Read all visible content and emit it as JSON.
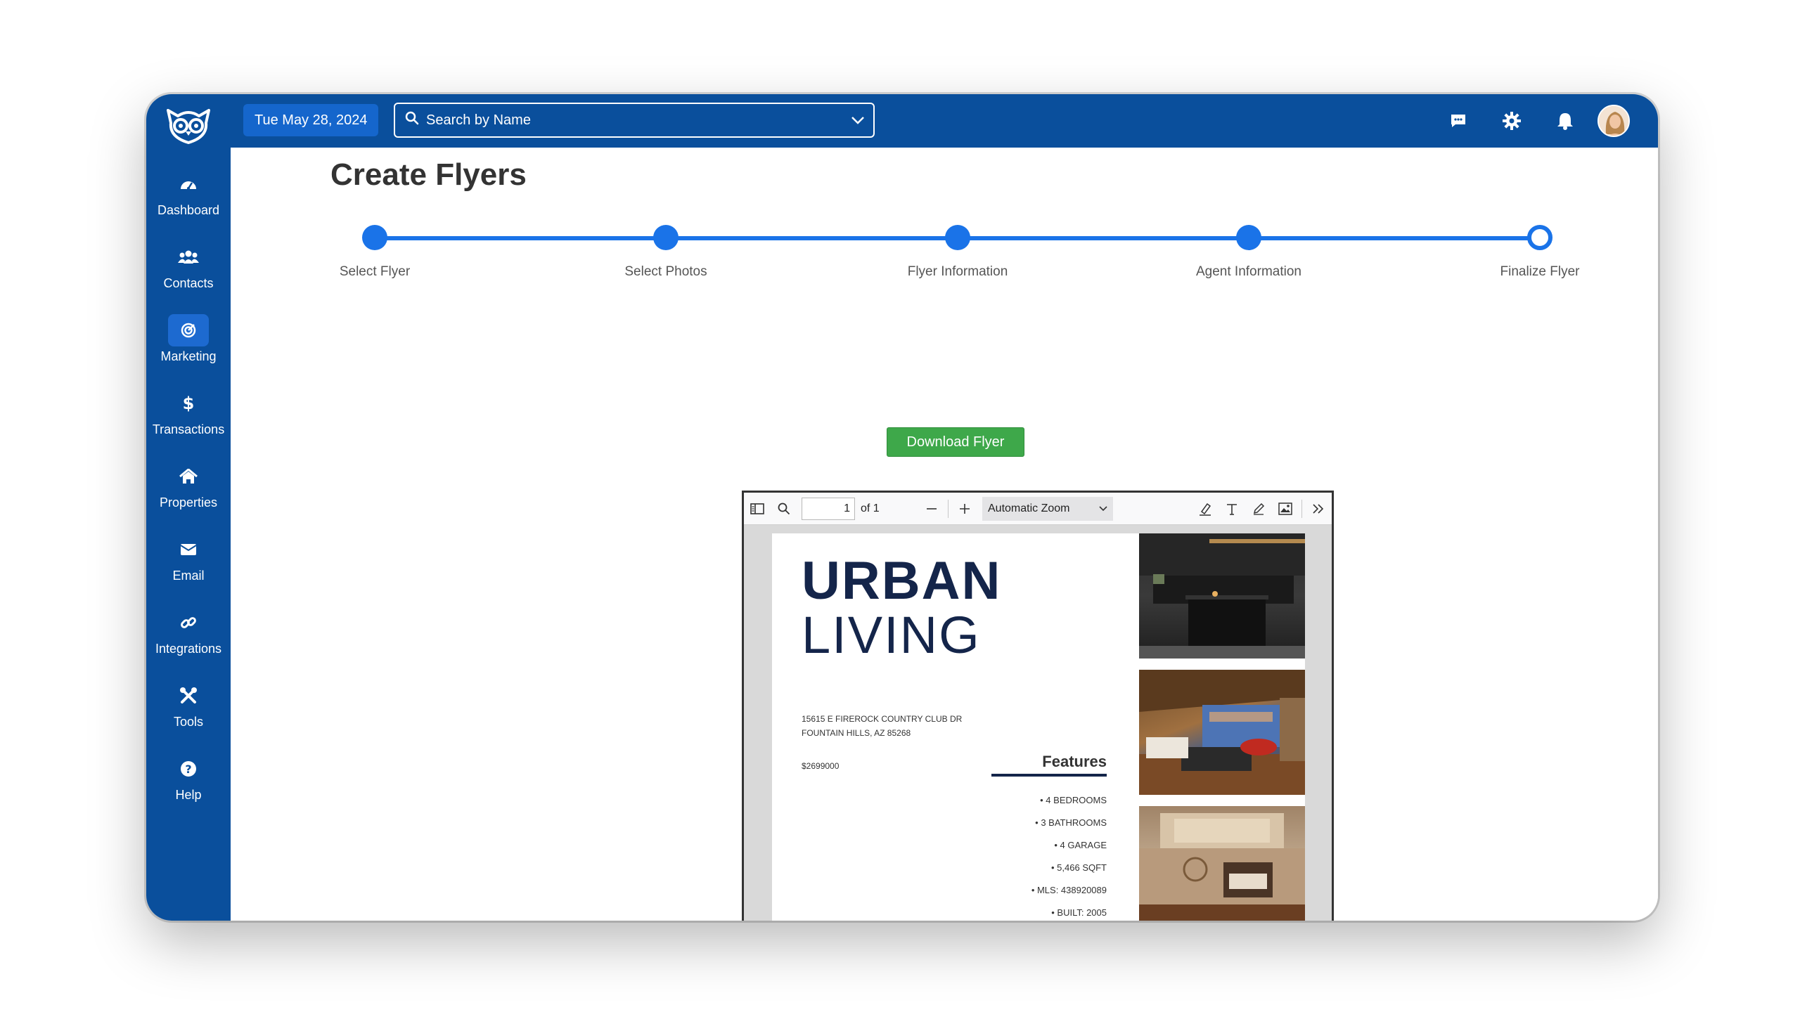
{
  "app": {
    "logo": "owl-logo-icon"
  },
  "sidebar": {
    "items": [
      {
        "label": "Dashboard",
        "icon": "dashboard-icon",
        "active": false
      },
      {
        "label": "Contacts",
        "icon": "contacts-icon",
        "active": false
      },
      {
        "label": "Marketing",
        "icon": "marketing-icon",
        "active": true
      },
      {
        "label": "Transactions",
        "icon": "dollar-icon",
        "active": false
      },
      {
        "label": "Properties",
        "icon": "home-icon",
        "active": false
      },
      {
        "label": "Email",
        "icon": "email-icon",
        "active": false
      },
      {
        "label": "Integrations",
        "icon": "link-icon",
        "active": false
      },
      {
        "label": "Tools",
        "icon": "tools-icon",
        "active": false
      },
      {
        "label": "Help",
        "icon": "help-icon",
        "active": false
      }
    ]
  },
  "topbar": {
    "date": "Tue May 28, 2024",
    "search_placeholder": "Search by Name"
  },
  "page": {
    "title": "Create Flyers",
    "steps": [
      {
        "label": "Select Flyer",
        "state": "done"
      },
      {
        "label": "Select Photos",
        "state": "done"
      },
      {
        "label": "Flyer Information",
        "state": "done"
      },
      {
        "label": "Agent Information",
        "state": "done"
      },
      {
        "label": "Finalize Flyer",
        "state": "current"
      }
    ],
    "download_label": "Download Flyer"
  },
  "viewer": {
    "page_number": "1",
    "page_count": "of 1",
    "zoom": "Automatic Zoom"
  },
  "flyer": {
    "title_line1": "URBAN",
    "title_line2": "LIVING",
    "address_line1": "15615 E FIREROCK COUNTRY CLUB DR",
    "address_line2": "FOUNTAIN HILLS, AZ 85268",
    "price": "$2699000",
    "features_heading": "Features",
    "features": [
      "• 4 BEDROOMS",
      "• 3 BATHROOMS",
      "• 4 GARAGE",
      "• 5,466 SQFT",
      "• MLS: 438920089",
      "• BUILT: 2005"
    ]
  },
  "colors": {
    "brand": "#0a4f9c",
    "accent": "#1a73e8",
    "success": "#3ea84a",
    "flyer_navy": "#14254a"
  }
}
